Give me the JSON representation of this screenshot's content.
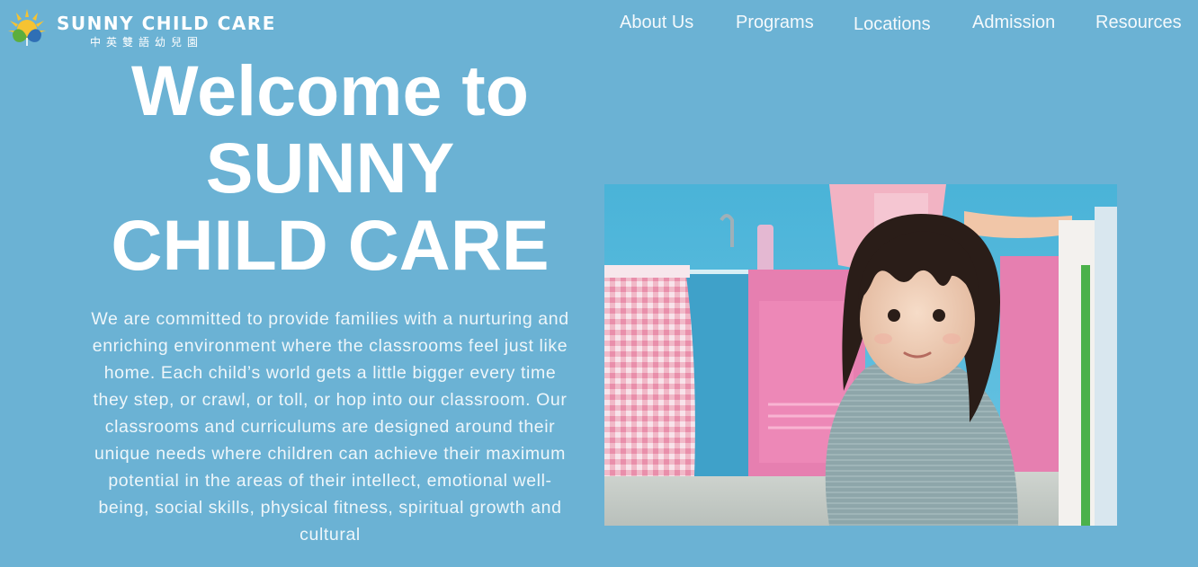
{
  "header": {
    "logo_title": "SUNNY CHILD CARE",
    "logo_subtitle": "中英雙語幼兒園"
  },
  "nav": {
    "items": [
      "About Us",
      "Programs",
      "Locations",
      "Admission",
      "Resources"
    ]
  },
  "hero": {
    "title_lines": [
      "Welcome to",
      "SUNNY",
      "CHILD CARE"
    ],
    "body": "We are committed to provide families with a nurturing and enriching environment where the classrooms feel just like home. Each child’s world gets a little bigger every time they step, or crawl, or toll, or hop into our classroom. Our classrooms and curriculums are designed around their unique needs where children can achieve their maximum potential in the areas of their intellect, emotional well-being, social skills, physical fitness, spiritual growth and cultural"
  },
  "colors": {
    "background": "#6bb2d4",
    "text": "#ffffff",
    "logo_sun": "#f6c332",
    "logo_leaf_green": "#5cae3d",
    "logo_leaf_blue": "#2f6fb5"
  },
  "icons": {
    "logo": "sun-leaf-logo-icon",
    "photo": "toddler-classroom-photo"
  }
}
